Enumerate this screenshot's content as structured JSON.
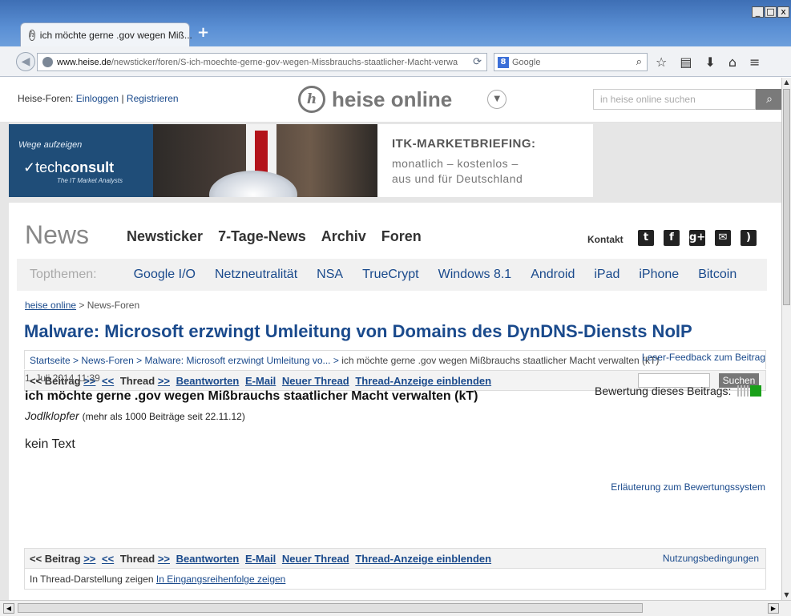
{
  "browser": {
    "tab_title": "ich möchte gerne .gov wegen Miß...",
    "new_tab": "+",
    "url_host": "www.heise.de",
    "url_path": "/newsticker/foren/S-ich-moechte-gerne-gov-wegen-Missbrauchs-staatlicher-Macht-verwal",
    "search_placeholder": "Google",
    "win_min": "_",
    "win_max": "□",
    "win_close": "x"
  },
  "header": {
    "foren_prefix": "Heise-Foren:",
    "login": "Einloggen",
    "sep": "|",
    "register": "Registrieren",
    "logo_text": "heise online",
    "site_search_placeholder": "in heise online suchen"
  },
  "banner": {
    "tagline": "Wege aufzeigen",
    "brand_light": "tech",
    "brand_bold": "consult",
    "brand_sub": "The IT Market Analysts",
    "headline": "ITK-MARKETBRIEFING:",
    "line1": "monatlich – kostenlos –",
    "line2": "aus und für Deutschland"
  },
  "nav": {
    "section": "News",
    "items": [
      "Newsticker",
      "7-Tage-News",
      "Archiv",
      "Foren"
    ],
    "kontakt": "Kontakt",
    "topthemen_label": "Topthemen:",
    "topthemen": [
      "Google I/O",
      "Netzneutralität",
      "NSA",
      "TrueCrypt",
      "Windows 8.1",
      "Android",
      "iPad",
      "iPhone",
      "Bitcoin"
    ]
  },
  "breadcrumb": {
    "home": "heise online",
    "sep": ">",
    "current": "News-Foren"
  },
  "article_headline": "Malware: Microsoft erzwingt Umleitung von Domains des DynDNS-Diensts NoIP",
  "forum_path": {
    "start": "Startseite",
    "foren": "News-Foren",
    "article": "Malware: Microsoft erzwingt Umleitung vo...",
    "current": "ich möchte gerne .gov wegen Mißbrauchs staatlicher Macht verwalten (kT)"
  },
  "toolbar": {
    "beitrag_prev": "<< Beitrag",
    "beitrag_next": ">>",
    "thread_prev": "<<",
    "thread_label": "Thread",
    "thread_next": ">>",
    "reply": "Beantworten",
    "email": "E-Mail",
    "new_thread": "Neuer Thread",
    "show_thread": "Thread-Anzeige einblenden",
    "search_button": "Suchen",
    "terms": "Nutzungsbedingungen"
  },
  "post": {
    "feedback": "Leser-Feedback zum Beitrag",
    "date": "1. Juli 2014 11:39",
    "title": "ich möchte gerne .gov wegen Mißbrauchs staatlicher Macht verwalten (kT)",
    "author": "Jodlklopfer",
    "author_meta": "(mehr als 1000 Beiträge seit 22.11.12)",
    "body": "kein Text",
    "rating_label": "Bewertung dieses Beitrags:",
    "rating_explain": "Erläuterung zum Bewertungssystem",
    "rating_color": "#19a019"
  },
  "footer": {
    "prefix": "In Thread-Darstellung zeigen",
    "link": "In Eingangsreihenfolge zeigen"
  }
}
